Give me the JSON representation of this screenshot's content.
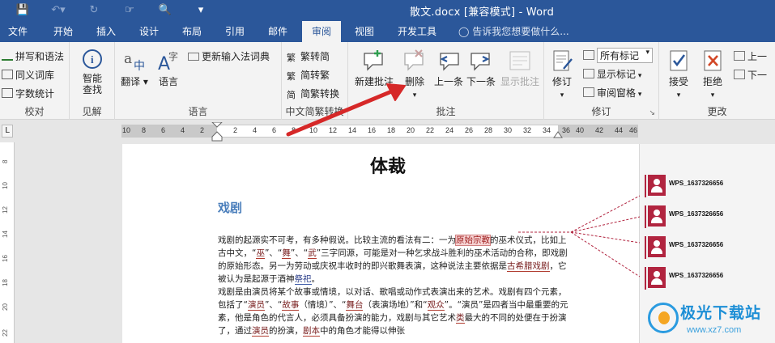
{
  "title_bar": {
    "doc_title": "散文.docx [兼容模式] - Word",
    "qat_icons": [
      "save-icon",
      "undo-icon",
      "redo-icon",
      "touch-mode-icon",
      "print-preview-icon",
      "customize-qat-icon"
    ]
  },
  "tabs": [
    {
      "label": "文件",
      "active": false
    },
    {
      "label": "开始",
      "active": false
    },
    {
      "label": "插入",
      "active": false
    },
    {
      "label": "设计",
      "active": false
    },
    {
      "label": "布局",
      "active": false
    },
    {
      "label": "引用",
      "active": false
    },
    {
      "label": "邮件",
      "active": false
    },
    {
      "label": "审阅",
      "active": true
    },
    {
      "label": "视图",
      "active": false
    },
    {
      "label": "开发工具",
      "active": false
    }
  ],
  "tell_me": "告诉我您想要做什么...",
  "ribbon": {
    "proofing": {
      "label": "校对",
      "spell": "拼写和语法",
      "thesaurus": "同义词库",
      "wordcount": "字数统计"
    },
    "insights": {
      "label": "见解",
      "smart_lookup": "智能\n查找"
    },
    "language": {
      "label": "语言",
      "translate": "翻译",
      "language": "语言",
      "update_ime": "更新输入法词典"
    },
    "chinese": {
      "label": "中文简繁转换",
      "to_simplified": "繁转简",
      "to_traditional": "简转繁",
      "convert": "简繁转换"
    },
    "comments": {
      "label": "批注",
      "new": "新建批注",
      "delete": "删除",
      "prev": "上一条",
      "next": "下一条",
      "show": "显示批注"
    },
    "tracking": {
      "label": "修订",
      "track": "修订",
      "markup_select": "所有标记",
      "show_markup": "显示标记",
      "review_pane": "审阅窗格"
    },
    "changes": {
      "label": "更改",
      "accept": "接受",
      "reject": "拒绝",
      "prev": "上一",
      "next": "下一"
    }
  },
  "ruler": {
    "numbers": [
      "10",
      "8",
      "6",
      "4",
      "2",
      "2",
      "4",
      "6",
      "8",
      "10",
      "12",
      "14",
      "16",
      "18",
      "20",
      "22",
      "24",
      "26",
      "28",
      "30",
      "32",
      "34",
      "36",
      "40",
      "42",
      "44",
      "46"
    ],
    "vertical_numbers": [
      "8",
      "10",
      "12",
      "14",
      "16",
      "18",
      "20",
      "22"
    ]
  },
  "document": {
    "heading": "体裁",
    "subheading": "戏剧",
    "p1": {
      "a": "戏剧的起源实不可考，有多种假说。比较主流的看法有二：一为",
      "hl": "原始宗教",
      "b": "的巫术仪式，比如上古中文，“",
      "w1": "巫",
      "c": "”、“",
      "w2": "舞",
      "d": "”、“",
      "w3": "武",
      "e": "”三字同源，可能是对一种乞求战斗胜利的巫术活动的合称，即戏剧的原始形态。另一为劳动或庆祝丰收时的即兴歌舞表演，这种说法主要依据是",
      "w4": "古希腊戏剧",
      "f": "，它被认为是起源于酒神",
      "w5": "祭祀",
      "g": "。"
    },
    "p2": {
      "a": "戏剧是由演员将某个故事或情境，以对话、歌唱或动作式表演出来的艺术。戏剧有四个元素，包括了“",
      "w1": "演员",
      "b": "”、“",
      "w2": "故事",
      "c": "（情境）”、“",
      "w3": "舞台",
      "d": "（表演场地）”和“",
      "w4": "观众",
      "e": "”。“演员”是四者当中最重要的元素，他是角色的代言人，必须具备扮演的能力，戏剧与其它艺术",
      "w5": "类",
      "f": "最大的不同的处便在于扮演了，通过",
      "w6": "演员",
      "g": "的扮演，",
      "w7": "剧本",
      "h": "中的角色才能得以伸张"
    }
  },
  "comments": [
    {
      "author": "WPS_1637326656"
    },
    {
      "author": "WPS_1637326656"
    },
    {
      "author": "WPS_1637326656"
    },
    {
      "author": "WPS_1637326656"
    }
  ],
  "watermark": {
    "name": "极光下载站",
    "url": "www.xz7.com"
  },
  "colors": {
    "ribbon_blue": "#2b579a",
    "comment_red": "#b1243f",
    "arrow_red": "#d62828",
    "heading_blue": "#4a7ebb"
  }
}
